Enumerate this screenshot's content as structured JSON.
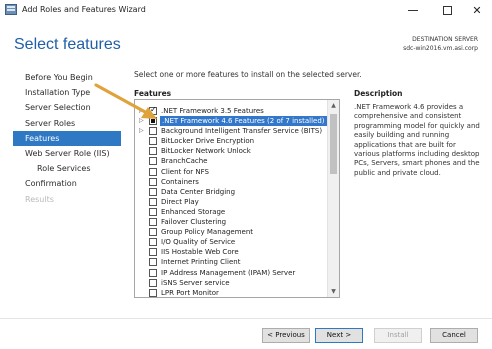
{
  "window": {
    "title": "Add Roles and Features Wizard"
  },
  "header": {
    "page_title": "Select features",
    "destination_label": "DESTINATION SERVER",
    "destination_server": "sdc-win2016.vm.asi.corp"
  },
  "nav": {
    "items": [
      {
        "label": "Before You Begin",
        "state": "normal"
      },
      {
        "label": "Installation Type",
        "state": "normal"
      },
      {
        "label": "Server Selection",
        "state": "normal"
      },
      {
        "label": "Server Roles",
        "state": "normal"
      },
      {
        "label": "Features",
        "state": "active"
      },
      {
        "label": "Web Server Role (IIS)",
        "state": "normal"
      },
      {
        "label": "Role Services",
        "state": "normal"
      },
      {
        "label": "Confirmation",
        "state": "normal"
      },
      {
        "label": "Results",
        "state": "disabled"
      }
    ]
  },
  "main": {
    "instruction": "Select one or more features to install on the selected server.",
    "features_label": "Features",
    "description_label": "Description",
    "description_text": ".NET Framework 4.6 provides a comprehensive and consistent programming model for quickly and easily building and running applications that are built for various platforms including desktop PCs, Servers, smart phones and the public and private cloud.",
    "features": [
      {
        "label": ".NET Framework 3.5 Features",
        "expandable": true,
        "check": "checked",
        "selected": false
      },
      {
        "label": ".NET Framework 4.6 Features (2 of 7 installed)",
        "expandable": true,
        "check": "partial",
        "selected": true
      },
      {
        "label": "Background Intelligent Transfer Service (BITS)",
        "expandable": true,
        "check": "none",
        "selected": false
      },
      {
        "label": "BitLocker Drive Encryption",
        "expandable": false,
        "check": "none",
        "selected": false
      },
      {
        "label": "BitLocker Network Unlock",
        "expandable": false,
        "check": "none",
        "selected": false
      },
      {
        "label": "BranchCache",
        "expandable": false,
        "check": "none",
        "selected": false
      },
      {
        "label": "Client for NFS",
        "expandable": false,
        "check": "none",
        "selected": false
      },
      {
        "label": "Containers",
        "expandable": false,
        "check": "none",
        "selected": false
      },
      {
        "label": "Data Center Bridging",
        "expandable": false,
        "check": "none",
        "selected": false
      },
      {
        "label": "Direct Play",
        "expandable": false,
        "check": "none",
        "selected": false
      },
      {
        "label": "Enhanced Storage",
        "expandable": false,
        "check": "none",
        "selected": false
      },
      {
        "label": "Failover Clustering",
        "expandable": false,
        "check": "none",
        "selected": false
      },
      {
        "label": "Group Policy Management",
        "expandable": false,
        "check": "none",
        "selected": false
      },
      {
        "label": "I/O Quality of Service",
        "expandable": false,
        "check": "none",
        "selected": false
      },
      {
        "label": "IIS Hostable Web Core",
        "expandable": false,
        "check": "none",
        "selected": false
      },
      {
        "label": "Internet Printing Client",
        "expandable": false,
        "check": "none",
        "selected": false
      },
      {
        "label": "IP Address Management (IPAM) Server",
        "expandable": false,
        "check": "none",
        "selected": false
      },
      {
        "label": "iSNS Server service",
        "expandable": false,
        "check": "none",
        "selected": false
      },
      {
        "label": "LPR Port Monitor",
        "expandable": false,
        "check": "none",
        "selected": false
      }
    ]
  },
  "buttons": {
    "previous": "< Previous",
    "next": "Next >",
    "install": "Install",
    "cancel": "Cancel"
  },
  "colors": {
    "accent": "#2f78c4",
    "title_blue": "#1f5fa5",
    "annotation_arrow": "#e0a23a"
  },
  "icons": {
    "app": "server-manager-icon",
    "minimize": "minimize-icon",
    "maximize": "maximize-icon",
    "close": "close-icon",
    "annotation": "arrow-pointer-icon"
  }
}
